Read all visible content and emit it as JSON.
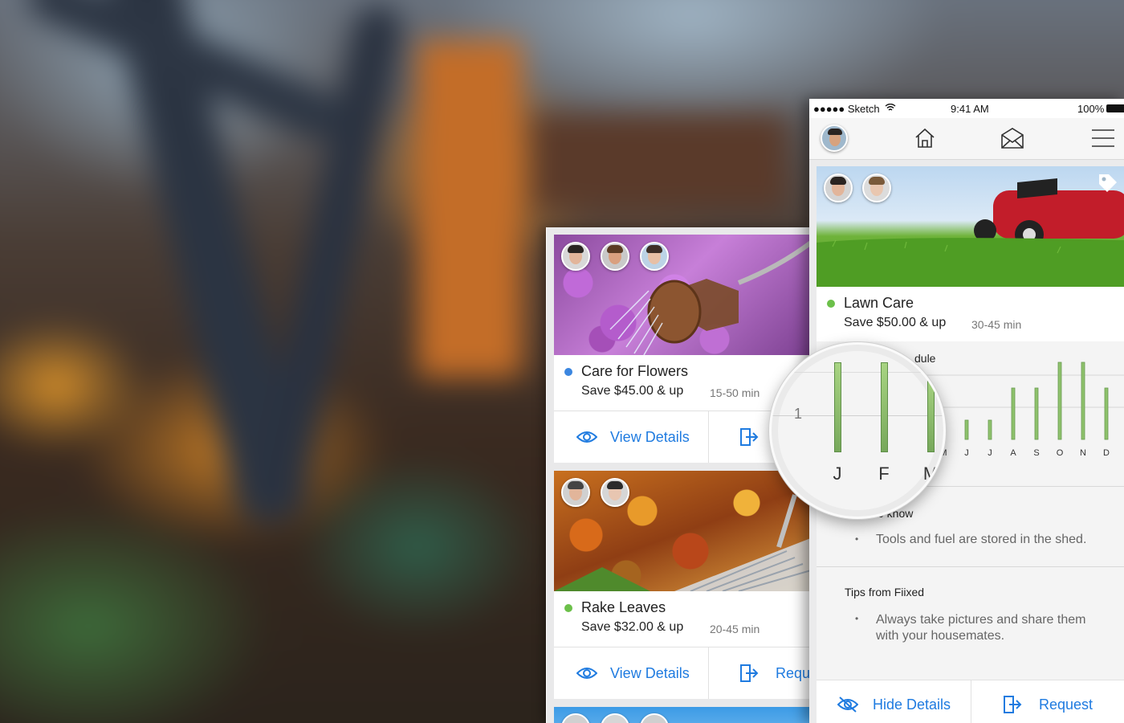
{
  "left_phone": {
    "cards": [
      {
        "title": "Care for Flowers",
        "save": "Save $45.00 & up",
        "duration": "15-50 min",
        "status_color": "#3b86e0",
        "view_label": "View Details",
        "request_label": "Request"
      },
      {
        "title": "Rake Leaves",
        "save": "Save $32.00 & up",
        "duration": "20-45 min",
        "status_color": "#6cc04a",
        "view_label": "View Details",
        "request_label": "Requ"
      }
    ]
  },
  "right_phone": {
    "status_bar": {
      "carrier": "●●●●● Sketch",
      "time": "9:41 AM",
      "battery": "100%"
    },
    "task": {
      "title": "Lawn Care",
      "save": "Save $50.00 & up",
      "duration": "30-45 min",
      "status_color": "#6cc04a"
    },
    "schedule": {
      "title_visible": "dule",
      "axis_tick": "1",
      "months_visible": [
        "M",
        "J",
        "J",
        "A",
        "S",
        "O",
        "N",
        "D"
      ],
      "magnified_months": [
        "J",
        "F",
        "M"
      ]
    },
    "good_to_know": {
      "title_visible": "o know",
      "items": [
        "Tools and fuel are stored in the shed."
      ]
    },
    "tips": {
      "title": "Tips from Fiixed",
      "items": [
        "Always take pictures and share them with your housemates."
      ]
    },
    "actions": {
      "hide_label": "Hide Details",
      "request_label": "Request"
    }
  },
  "chart_data": {
    "type": "bar",
    "categories": [
      "J",
      "F",
      "M",
      "A",
      "M",
      "J",
      "J",
      "A",
      "S",
      "O",
      "N",
      "D"
    ],
    "values": [
      1.6,
      1.6,
      1.4,
      0.3,
      0.3,
      0.3,
      0.3,
      0.8,
      0.8,
      1.2,
      1.2,
      0.8
    ],
    "ylim": [
      0,
      2
    ],
    "xlabel": "",
    "ylabel": "",
    "grid": true
  },
  "colors": {
    "accent_blue": "#1f7be0",
    "bar_green": "#8ec16c"
  },
  "icons": [
    "avatar",
    "home-icon",
    "mail-icon",
    "menu-icon",
    "eye-icon",
    "request-icon",
    "eye-off-icon",
    "tag-icon"
  ]
}
